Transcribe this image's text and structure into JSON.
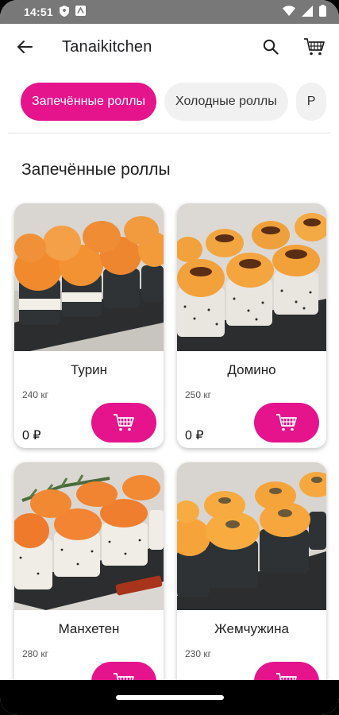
{
  "status_bar": {
    "time": "14:51"
  },
  "app_bar": {
    "title": "Tanaikitchen"
  },
  "categories": [
    {
      "label": "Запечённые роллы",
      "active": true
    },
    {
      "label": "Холодные роллы",
      "active": false
    },
    {
      "label": "Р",
      "active": false
    }
  ],
  "section": {
    "title": "Запечённые роллы"
  },
  "products": [
    {
      "name": "Турин",
      "weight": "240 кг",
      "price": "0 ₽"
    },
    {
      "name": "Домино",
      "weight": "250 кг",
      "price": "0 ₽"
    },
    {
      "name": "Манхетен",
      "weight": "280 кг",
      "price": ""
    },
    {
      "name": "Жемчужина",
      "weight": "230 кг",
      "price": ""
    }
  ],
  "colors": {
    "accent": "#e6148c",
    "status_bar": "#787878"
  }
}
